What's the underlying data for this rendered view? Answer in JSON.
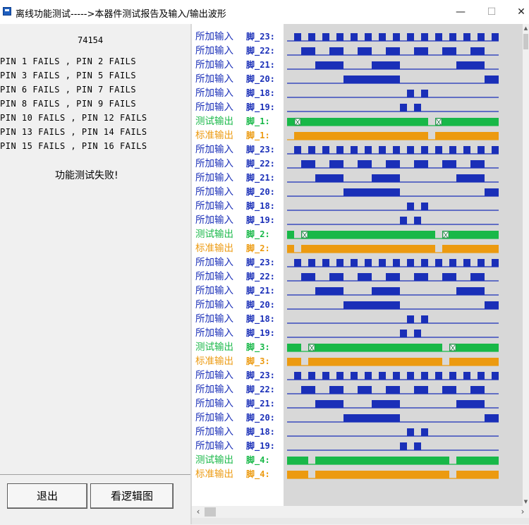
{
  "window": {
    "title": "离线功能测试----->本器件测试报告及输入/输出波形",
    "minimize_glyph": "—",
    "maximize_glyph": "☐",
    "close_glyph": "✕"
  },
  "report": {
    "chip": "74154",
    "fail_lines": [
      "PIN 1 FAILS , PIN 2 FAILS",
      "PIN 3 FAILS , PIN 5 FAILS",
      "PIN 6 FAILS , PIN 7 FAILS",
      "PIN 8 FAILS , PIN 9 FAILS",
      "PIN 10 FAILS , PIN 12 FAILS",
      "PIN 13 FAILS , PIN 14 FAILS",
      "PIN 15 FAILS , PIN 16 FAILS"
    ],
    "result": "功能测试失败!"
  },
  "buttons": {
    "exit_label": "退出",
    "logic_label": "看逻辑图"
  },
  "colors": {
    "input": "#1a2fb8",
    "test": "#18b848",
    "standard": "#ec9a10",
    "wave_bg": "#d8d8d8"
  },
  "waveform": {
    "periods": 30,
    "groups": [
      {
        "rows": [
          {
            "prefix": "所加输入",
            "pin": "脚_23:",
            "kind": "input",
            "highs": [
              [
                1,
                2
              ],
              [
                3,
                4
              ],
              [
                5,
                6
              ],
              [
                7,
                8
              ],
              [
                9,
                10
              ],
              [
                11,
                12
              ],
              [
                13,
                14
              ],
              [
                15,
                16
              ],
              [
                17,
                18
              ],
              [
                19,
                20
              ],
              [
                21,
                22
              ],
              [
                23,
                24
              ],
              [
                25,
                26
              ],
              [
                27,
                28
              ],
              [
                29,
                30
              ]
            ]
          },
          {
            "prefix": "所加输入",
            "pin": "脚_22:",
            "kind": "input",
            "highs": [
              [
                2,
                4
              ],
              [
                6,
                8
              ],
              [
                10,
                12
              ],
              [
                14,
                16
              ],
              [
                18,
                20
              ],
              [
                22,
                24
              ],
              [
                26,
                28
              ]
            ]
          },
          {
            "prefix": "所加输入",
            "pin": "脚_21:",
            "kind": "input",
            "highs": [
              [
                4,
                8
              ],
              [
                12,
                16
              ],
              [
                24,
                28
              ]
            ]
          },
          {
            "prefix": "所加输入",
            "pin": "脚_20:",
            "kind": "input",
            "highs": [
              [
                8,
                16
              ],
              [
                28,
                30
              ]
            ]
          },
          {
            "prefix": "所加输入",
            "pin": "脚_18:",
            "kind": "input",
            "highs": [
              [
                17,
                18
              ],
              [
                19,
                20
              ]
            ]
          },
          {
            "prefix": "所加输入",
            "pin": "脚_19:",
            "kind": "input",
            "highs": [
              [
                16,
                17
              ],
              [
                18,
                19
              ]
            ]
          },
          {
            "prefix": "测试输出",
            "pin": "脚_1:",
            "kind": "test",
            "highs": [
              [
                0,
                20
              ],
              [
                21,
                30
              ]
            ],
            "marks": [
              1,
              21
            ]
          },
          {
            "prefix": "标准输出",
            "pin": "脚_1:",
            "kind": "standard",
            "highs": [
              [
                1,
                20
              ],
              [
                21,
                30
              ]
            ]
          }
        ]
      },
      {
        "rows": [
          {
            "prefix": "所加输入",
            "pin": "脚_23:",
            "kind": "input",
            "highs": [
              [
                1,
                2
              ],
              [
                3,
                4
              ],
              [
                5,
                6
              ],
              [
                7,
                8
              ],
              [
                9,
                10
              ],
              [
                11,
                12
              ],
              [
                13,
                14
              ],
              [
                15,
                16
              ],
              [
                17,
                18
              ],
              [
                19,
                20
              ],
              [
                21,
                22
              ],
              [
                23,
                24
              ],
              [
                25,
                26
              ],
              [
                27,
                28
              ],
              [
                29,
                30
              ]
            ]
          },
          {
            "prefix": "所加输入",
            "pin": "脚_22:",
            "kind": "input",
            "highs": [
              [
                2,
                4
              ],
              [
                6,
                8
              ],
              [
                10,
                12
              ],
              [
                14,
                16
              ],
              [
                18,
                20
              ],
              [
                22,
                24
              ],
              [
                26,
                28
              ]
            ]
          },
          {
            "prefix": "所加输入",
            "pin": "脚_21:",
            "kind": "input",
            "highs": [
              [
                4,
                8
              ],
              [
                12,
                16
              ],
              [
                24,
                28
              ]
            ]
          },
          {
            "prefix": "所加输入",
            "pin": "脚_20:",
            "kind": "input",
            "highs": [
              [
                8,
                16
              ],
              [
                28,
                30
              ]
            ]
          },
          {
            "prefix": "所加输入",
            "pin": "脚_18:",
            "kind": "input",
            "highs": [
              [
                17,
                18
              ],
              [
                19,
                20
              ]
            ]
          },
          {
            "prefix": "所加输入",
            "pin": "脚_19:",
            "kind": "input",
            "highs": [
              [
                16,
                17
              ],
              [
                18,
                19
              ]
            ]
          },
          {
            "prefix": "测试输出",
            "pin": "脚_2:",
            "kind": "test",
            "highs": [
              [
                0,
                1
              ],
              [
                2,
                21
              ],
              [
                22,
                30
              ]
            ],
            "marks": [
              2,
              22
            ]
          },
          {
            "prefix": "标准输出",
            "pin": "脚_2:",
            "kind": "standard",
            "highs": [
              [
                0,
                1
              ],
              [
                2,
                21
              ],
              [
                22,
                30
              ]
            ]
          }
        ]
      },
      {
        "rows": [
          {
            "prefix": "所加输入",
            "pin": "脚_23:",
            "kind": "input",
            "highs": [
              [
                1,
                2
              ],
              [
                3,
                4
              ],
              [
                5,
                6
              ],
              [
                7,
                8
              ],
              [
                9,
                10
              ],
              [
                11,
                12
              ],
              [
                13,
                14
              ],
              [
                15,
                16
              ],
              [
                17,
                18
              ],
              [
                19,
                20
              ],
              [
                21,
                22
              ],
              [
                23,
                24
              ],
              [
                25,
                26
              ],
              [
                27,
                28
              ],
              [
                29,
                30
              ]
            ]
          },
          {
            "prefix": "所加输入",
            "pin": "脚_22:",
            "kind": "input",
            "highs": [
              [
                2,
                4
              ],
              [
                6,
                8
              ],
              [
                10,
                12
              ],
              [
                14,
                16
              ],
              [
                18,
                20
              ],
              [
                22,
                24
              ],
              [
                26,
                28
              ]
            ]
          },
          {
            "prefix": "所加输入",
            "pin": "脚_21:",
            "kind": "input",
            "highs": [
              [
                4,
                8
              ],
              [
                12,
                16
              ],
              [
                24,
                28
              ]
            ]
          },
          {
            "prefix": "所加输入",
            "pin": "脚_20:",
            "kind": "input",
            "highs": [
              [
                8,
                16
              ],
              [
                28,
                30
              ]
            ]
          },
          {
            "prefix": "所加输入",
            "pin": "脚_18:",
            "kind": "input",
            "highs": [
              [
                17,
                18
              ],
              [
                19,
                20
              ]
            ]
          },
          {
            "prefix": "所加输入",
            "pin": "脚_19:",
            "kind": "input",
            "highs": [
              [
                16,
                17
              ],
              [
                18,
                19
              ]
            ]
          },
          {
            "prefix": "测试输出",
            "pin": "脚_3:",
            "kind": "test",
            "highs": [
              [
                0,
                2
              ],
              [
                3,
                22
              ],
              [
                23,
                30
              ]
            ],
            "marks": [
              3,
              23
            ]
          },
          {
            "prefix": "标准输出",
            "pin": "脚_3:",
            "kind": "standard",
            "highs": [
              [
                0,
                2
              ],
              [
                3,
                22
              ],
              [
                23,
                30
              ]
            ]
          }
        ]
      },
      {
        "rows": [
          {
            "prefix": "所加输入",
            "pin": "脚_23:",
            "kind": "input",
            "highs": [
              [
                1,
                2
              ],
              [
                3,
                4
              ],
              [
                5,
                6
              ],
              [
                7,
                8
              ],
              [
                9,
                10
              ],
              [
                11,
                12
              ],
              [
                13,
                14
              ],
              [
                15,
                16
              ],
              [
                17,
                18
              ],
              [
                19,
                20
              ],
              [
                21,
                22
              ],
              [
                23,
                24
              ],
              [
                25,
                26
              ],
              [
                27,
                28
              ],
              [
                29,
                30
              ]
            ]
          },
          {
            "prefix": "所加输入",
            "pin": "脚_22:",
            "kind": "input",
            "highs": [
              [
                2,
                4
              ],
              [
                6,
                8
              ],
              [
                10,
                12
              ],
              [
                14,
                16
              ],
              [
                18,
                20
              ],
              [
                22,
                24
              ],
              [
                26,
                28
              ]
            ]
          },
          {
            "prefix": "所加输入",
            "pin": "脚_21:",
            "kind": "input",
            "highs": [
              [
                4,
                8
              ],
              [
                12,
                16
              ],
              [
                24,
                28
              ]
            ]
          },
          {
            "prefix": "所加输入",
            "pin": "脚_20:",
            "kind": "input",
            "highs": [
              [
                8,
                16
              ],
              [
                28,
                30
              ]
            ]
          },
          {
            "prefix": "所加输入",
            "pin": "脚_18:",
            "kind": "input",
            "highs": [
              [
                17,
                18
              ],
              [
                19,
                20
              ]
            ]
          },
          {
            "prefix": "所加输入",
            "pin": "脚_19:",
            "kind": "input",
            "highs": [
              [
                16,
                17
              ],
              [
                18,
                19
              ]
            ]
          },
          {
            "prefix": "测试输出",
            "pin": "脚_4:",
            "kind": "test",
            "highs": [
              [
                0,
                3
              ],
              [
                4,
                23
              ],
              [
                24,
                30
              ]
            ],
            "marks": []
          },
          {
            "prefix": "标准输出",
            "pin": "脚_4:",
            "kind": "standard",
            "highs": [
              [
                0,
                3
              ],
              [
                4,
                23
              ],
              [
                24,
                30
              ]
            ]
          }
        ]
      }
    ]
  }
}
